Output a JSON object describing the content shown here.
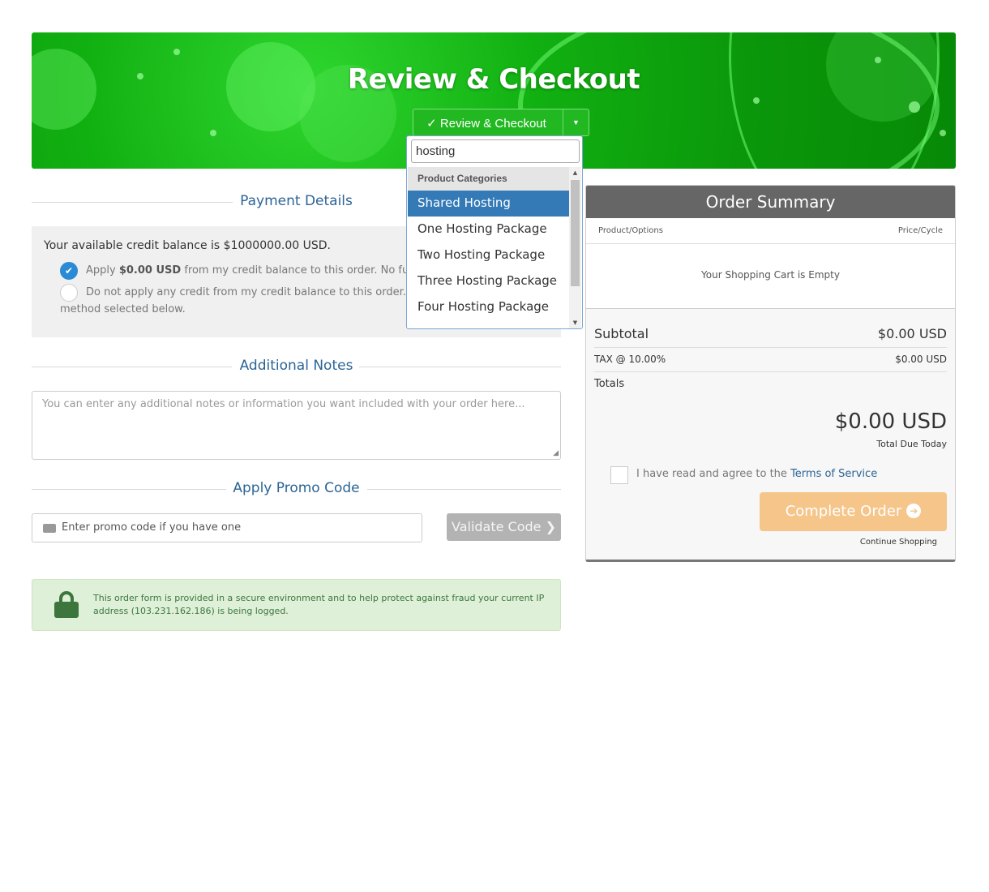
{
  "header": {
    "title": "Review & Checkout",
    "step_dropdown_label": "✓ Review & Checkout"
  },
  "dropdown": {
    "search_value": "hosting",
    "group_label": "Product Categories",
    "items": [
      {
        "label": "Shared Hosting"
      },
      {
        "label": "One Hosting Package"
      },
      {
        "label": "Two Hosting Package"
      },
      {
        "label": "Three Hosting Package"
      },
      {
        "label": "Four Hosting Package"
      }
    ],
    "selected": "Shared Hosting"
  },
  "payment": {
    "heading": "Payment Details",
    "balance_text": "Your available credit balance is $1000000.00 USD.",
    "option1_prefix": "Apply ",
    "option1_amount": "$0.00 USD",
    "option1_suffix": " from my credit balance to this order. No further pa",
    "option2_line1": "Do not apply any credit from my credit balance to this order. I will pa",
    "option2_line2": "method selected below."
  },
  "notes": {
    "heading": "Additional Notes",
    "placeholder": "You can enter any additional notes or information you want included with your order here..."
  },
  "promo": {
    "heading": "Apply Promo Code",
    "placeholder": "Enter promo code if you have one",
    "button_label": "Validate Code ❯"
  },
  "security": {
    "line1": "This order form is provided in a secure environment and to help protect against fraud your current IP",
    "line2": "address (103.231.162.186) is being logged."
  },
  "summary": {
    "title": "Order Summary",
    "col_product": "Product/Options",
    "col_price": "Price/Cycle",
    "empty_text": "Your Shopping Cart is Empty",
    "subtotal_label": "Subtotal",
    "subtotal_value": "$0.00 USD",
    "tax_label": "TAX @ 10.00%",
    "tax_value": "$0.00 USD",
    "totals_label": "Totals",
    "total_value": "$0.00 USD",
    "total_due_label": "Total Due Today",
    "tos_prefix": "I have read and agree to the ",
    "tos_link": "Terms of Service",
    "complete_label": "Complete Order",
    "continue_label": "Continue Shopping"
  },
  "colors": {
    "banner_green": "#11b011",
    "link_blue": "#2a6496",
    "selected_blue": "#337ab7",
    "complete_orange": "#f5c58a"
  }
}
